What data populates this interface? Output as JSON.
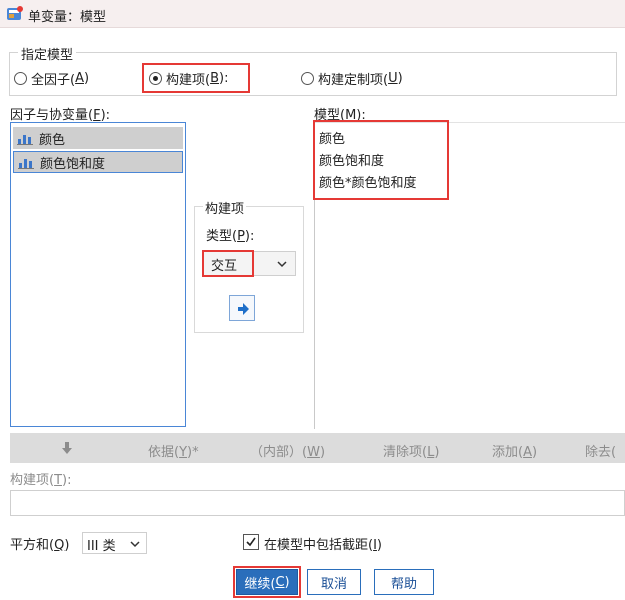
{
  "window": {
    "title": "单变量：模型"
  },
  "specify_model": {
    "legend": "指定模型",
    "options": [
      {
        "label": "全因子(",
        "hotkey": "A",
        "suffix": ")"
      },
      {
        "label": "构建项(",
        "hotkey": "B",
        "suffix": "):"
      },
      {
        "label": "构建定制项(",
        "hotkey": "U",
        "suffix": ")"
      }
    ],
    "selected": "构建项"
  },
  "factors": {
    "label": "因子与协变量(",
    "hotkey": "F",
    "suffix": "):",
    "items": [
      "颜色",
      "颜色饱和度"
    ]
  },
  "model": {
    "label": "模型(",
    "hotkey": "M",
    "suffix": "):",
    "items": [
      "颜色",
      "颜色饱和度",
      "颜色*颜色饱和度"
    ]
  },
  "build_term": {
    "title": "构建项",
    "type_label": "类型(",
    "type_hotkey": "P",
    "type_suffix": "):",
    "type_value": "交互"
  },
  "toolbar": {
    "by_label": "依据(",
    "by_hotkey": "Y",
    "by_suffix": ")*",
    "within_label": "（内部）(",
    "within_hotkey": "W",
    "within_suffix": ")",
    "clear_label": "清除项(",
    "clear_hotkey": "L",
    "clear_suffix": ")",
    "add_label": "添加(",
    "add_hotkey": "A",
    "add_suffix": ")",
    "remove_label": "除去("
  },
  "terms": {
    "label": "构建项(",
    "hotkey": "T",
    "suffix": "):",
    "value": ""
  },
  "sum_of_squares": {
    "label": "平方和(",
    "hotkey": "Q",
    "suffix": ")",
    "value": "III 类"
  },
  "intercept": {
    "label": "在模型中包括截距(",
    "hotkey": "I",
    "suffix": ")",
    "checked": true
  },
  "buttons": {
    "continue_label": "继续(",
    "continue_hotkey": "C",
    "continue_suffix": ")",
    "cancel": "取消",
    "help": "帮助"
  },
  "colors": {
    "highlight": "#e53935",
    "accent": "#2a6ebb",
    "selection_border": "#4a86d6"
  },
  "icons": {
    "title": "spss-dialog-icon",
    "variable": "nominal-bar-chart-icon",
    "move": "arrow-right-icon",
    "dropdown": "chevron-down-icon",
    "checkbox": "check-icon"
  }
}
